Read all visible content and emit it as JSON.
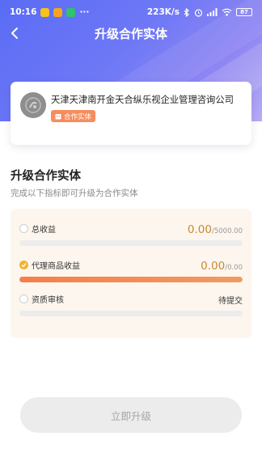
{
  "status_bar": {
    "time": "10:16",
    "more": "···",
    "network_speed": "223K/s",
    "battery_level": "87",
    "icons": [
      "app-icon-yellow",
      "app-icon-orange",
      "app-icon-green",
      "bluetooth-icon",
      "alarm-icon",
      "signal-icon",
      "wifi-icon",
      "battery-icon"
    ]
  },
  "header": {
    "title": "升级合作实体",
    "back_icon": "chevron-left-icon"
  },
  "company": {
    "name": "天津天津南开金天合纵乐视企业管理咨询公司",
    "badge": "合作实体",
    "badge_color": "#f58d5c"
  },
  "section": {
    "title": "升级合作实体",
    "subtitle": "完成以下指标即可升级为合作实体"
  },
  "metrics": [
    {
      "label": "总收益",
      "current": "0.00",
      "target": "/5000.00",
      "progress": 0,
      "completed": false
    },
    {
      "label": "代理商品收益",
      "current": "0.00",
      "target": "/0.00",
      "progress": 1,
      "completed": true
    },
    {
      "label": "资质审核",
      "status": "待提交",
      "progress": 0,
      "completed": false
    }
  ],
  "actions": {
    "upgrade_label": "立即升级",
    "upgrade_enabled": false
  },
  "colors": {
    "primary_gradient_start": "#5a6cf5",
    "primary_gradient_end": "#b7acf5",
    "accent_orange": "#f47f47",
    "value_gold": "#c88a2f"
  }
}
